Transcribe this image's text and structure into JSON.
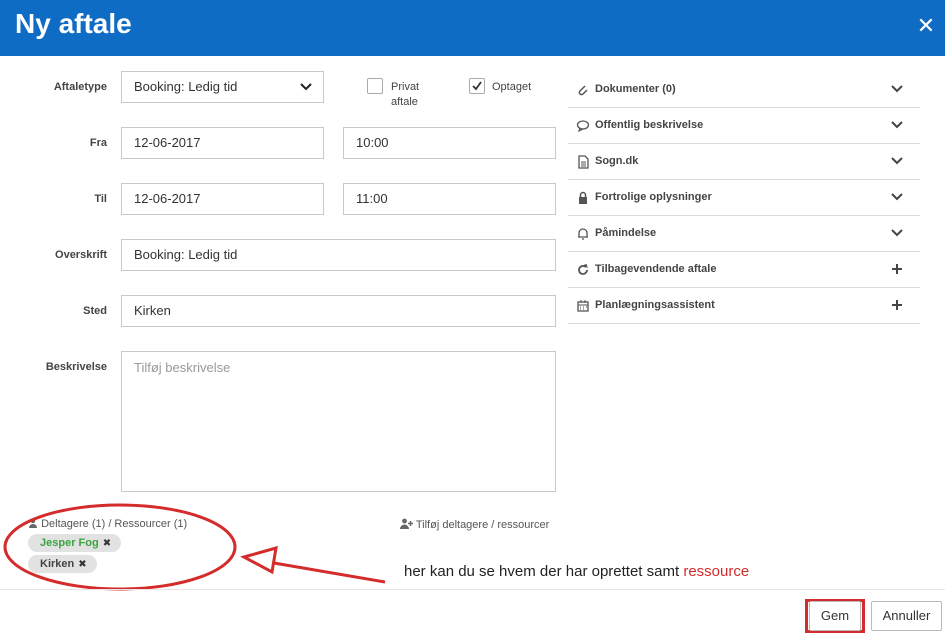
{
  "dialog": {
    "title": "Ny aftale",
    "close_glyph": "✕"
  },
  "form": {
    "type_label": "Aftaletype",
    "type_value": "Booking: Ledig tid",
    "private_label_1": "Privat",
    "private_label_2": "aftale",
    "private_checked": false,
    "busy_label": "Optaget",
    "busy_checked": true,
    "from_label": "Fra",
    "from_date": "12-06-2017",
    "from_time": "10:00",
    "to_label": "Til",
    "to_date": "12-06-2017",
    "to_time": "11:00",
    "heading_label": "Overskrift",
    "heading_value": "Booking: Ledig tid",
    "place_label": "Sted",
    "place_value": "Kirken",
    "description_label": "Beskrivelse",
    "description_placeholder": "Tilføj beskrivelse"
  },
  "accordion": [
    {
      "label": "Dokumenter (0)",
      "icon": "paperclip-icon",
      "end": "chevron"
    },
    {
      "label": "Offentlig beskrivelse",
      "icon": "speech-bubble-icon",
      "end": "chevron"
    },
    {
      "label": "Sogn.dk",
      "icon": "document-icon",
      "end": "chevron"
    },
    {
      "label": "Fortrolige oplysninger",
      "icon": "lock-icon",
      "end": "chevron"
    },
    {
      "label": "Påmindelse",
      "icon": "bell-icon",
      "end": "chevron"
    },
    {
      "label": "Tilbagevendende aftale",
      "icon": "refresh-icon",
      "end": "plus"
    },
    {
      "label": "Planlægningsassistent",
      "icon": "calendar-icon",
      "end": "plus"
    }
  ],
  "participants": {
    "heading": "Deltagere (1) / Ressourcer (1)",
    "add_label": "Tilføj deltagere / ressourcer",
    "tags": [
      {
        "label": "Jesper Fog",
        "color": "#3aa541"
      },
      {
        "label": "Kirken",
        "color": "#444444"
      }
    ],
    "remove_glyph": "✖"
  },
  "annotation": {
    "text": "her kan du se hvem der har oprettet samt",
    "highlight": "ressource",
    "color": "#d42b2b"
  },
  "footer": {
    "save_label": "Gem",
    "cancel_label": "Annuller"
  }
}
